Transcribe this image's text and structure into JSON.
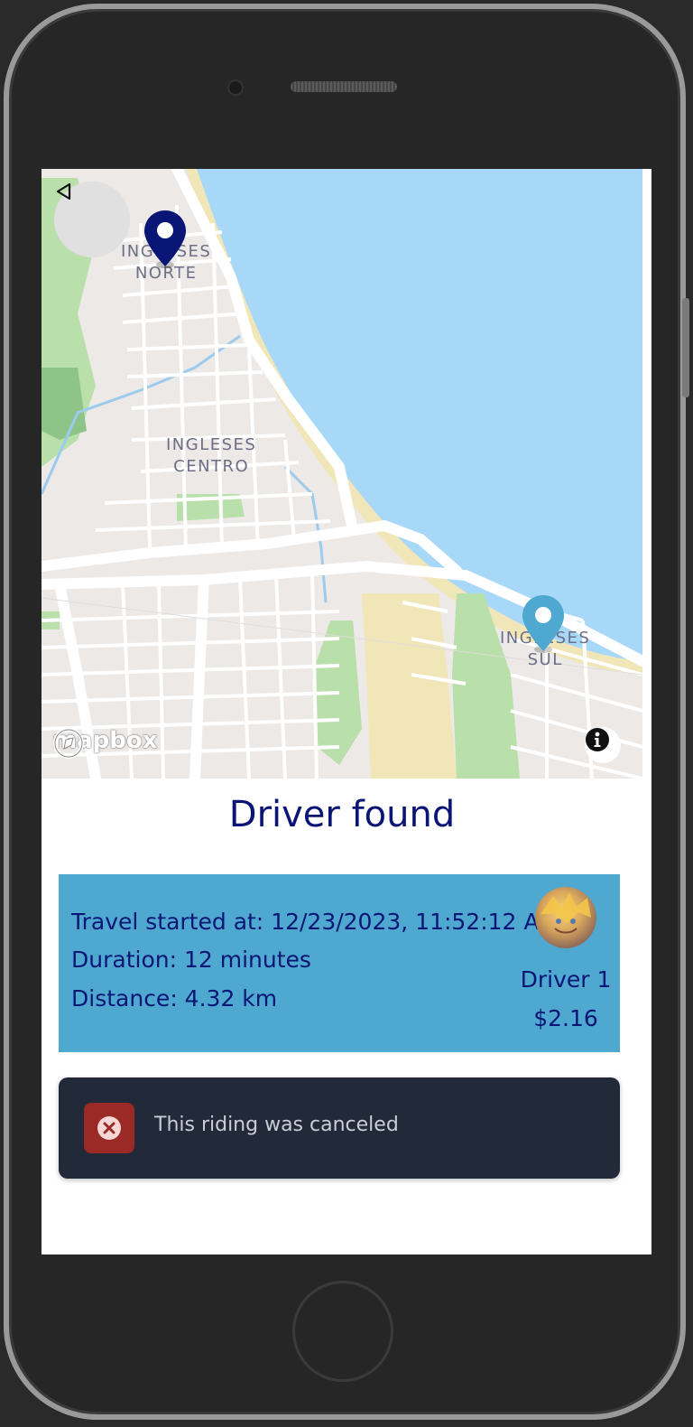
{
  "map": {
    "labels": {
      "north": [
        "INGLESES",
        "NORTE"
      ],
      "center": [
        "INGLESES",
        "CENTRO"
      ],
      "south": [
        "INGLESES",
        "SUL"
      ]
    },
    "attribution": "mapbox",
    "colors": {
      "water": "#a8d8f8",
      "land": "#ece9e7",
      "park": "#b9dfaa",
      "sand": "#f1e6b8",
      "road": "#ffffff"
    }
  },
  "icons": {
    "back": "back-triangle-icon",
    "origin_pin": "origin-pin-icon",
    "destination_pin": "destination-pin-icon",
    "info": "info-icon",
    "error": "error-x-icon"
  },
  "title": "Driver found",
  "trip": {
    "started": "Travel started at: 12/23/2023, 11:52:12 AM",
    "duration": "Duration: 12 minutes",
    "distance": "Distance: 4.32 km",
    "driver_name": "Driver 1",
    "price": "$2.16"
  },
  "toast": {
    "message": "This riding was canceled"
  },
  "colors": {
    "accent": "#0a1675",
    "card": "#4fa8cf",
    "toast_bg": "#222a3a",
    "toast_icon_bg": "#9b2a26",
    "origin_pin": "#0a1675",
    "destination_pin": "#4fa8cf"
  }
}
